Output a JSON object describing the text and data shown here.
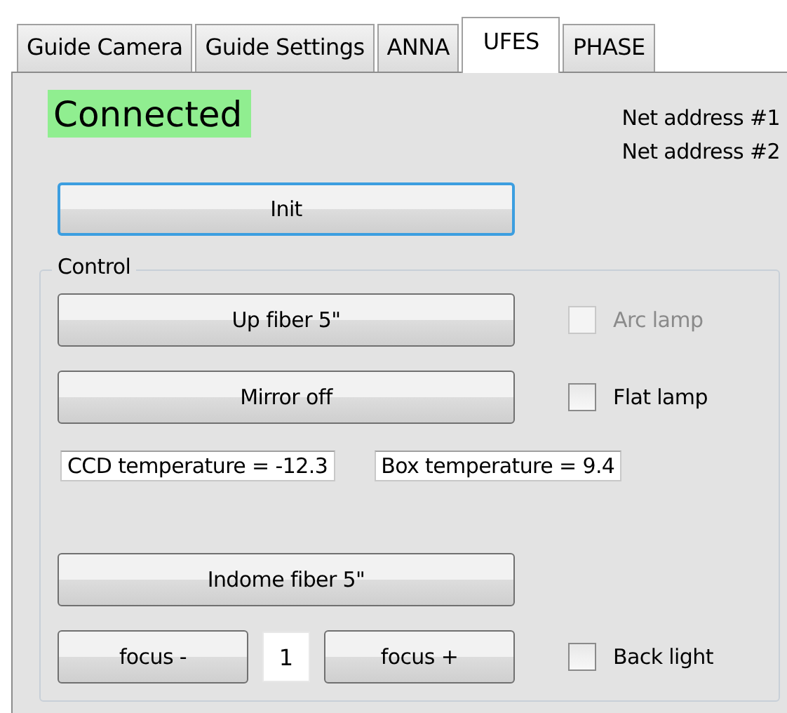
{
  "tabs": [
    {
      "label": "Guide Camera",
      "selected": false
    },
    {
      "label": "Guide Settings",
      "selected": false
    },
    {
      "label": "ANNA",
      "selected": false
    },
    {
      "label": "UFES",
      "selected": true
    },
    {
      "label": "PHASE",
      "selected": false
    }
  ],
  "status": {
    "text": "Connected",
    "connected": true
  },
  "net_addresses": [
    "Net address #1",
    "Net address #2"
  ],
  "init_button": {
    "label": "Init",
    "focused": true
  },
  "control": {
    "title": "Control",
    "up_fiber_button": "Up fiber 5\"",
    "arc_lamp": {
      "label": "Arc lamp",
      "checked": false,
      "disabled": true
    },
    "mirror_button": "Mirror off",
    "flat_lamp": {
      "label": "Flat lamp",
      "checked": false,
      "disabled": false
    },
    "readouts": [
      "CCD temperature = -12.3",
      "Box temperature = 9.4"
    ],
    "indome_fiber_button": "Indome fiber 5\"",
    "focus_minus_button": "focus -",
    "focus_step": "1",
    "focus_plus_button": "focus +",
    "back_light": {
      "label": "Back light",
      "checked": false,
      "disabled": false
    }
  }
}
